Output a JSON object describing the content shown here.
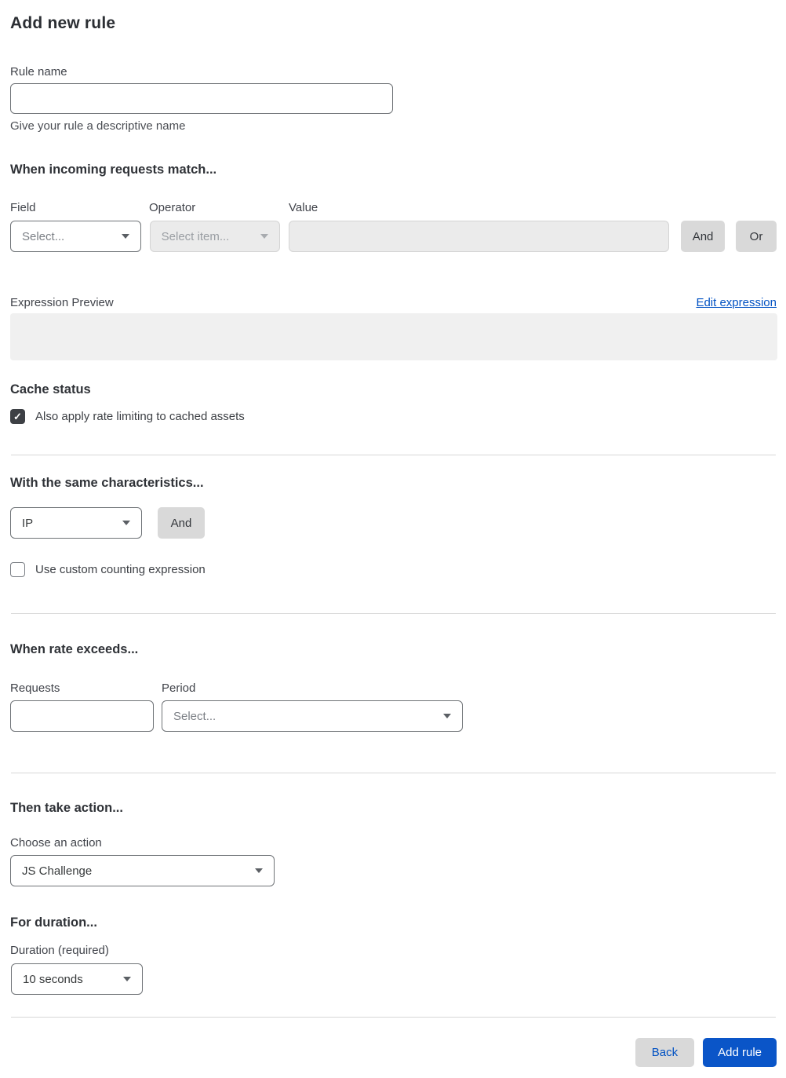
{
  "page": {
    "title": "Add new rule"
  },
  "colors": {
    "accent_blue": "#0051c3",
    "button_blue": "#0a55c8",
    "gray_button": "#d9d9d9",
    "disabled_bg": "#ebebeb",
    "preview_bg": "#f0f0f0"
  },
  "icons": {
    "checkmark": "✓"
  },
  "rule_name": {
    "label": "Rule name",
    "value": "",
    "helper": "Give your rule a descriptive name"
  },
  "match_section": {
    "heading": "When incoming requests match...",
    "field": {
      "label": "Field",
      "selected": "Select..."
    },
    "operator": {
      "label": "Operator",
      "selected": "Select item...",
      "disabled": true
    },
    "value": {
      "label": "Value",
      "value": "",
      "disabled": true
    },
    "and_button": "And",
    "or_button": "Or",
    "expression_preview_label": "Expression Preview",
    "edit_expression_link": "Edit expression",
    "expression_preview_value": ""
  },
  "cache_status": {
    "heading": "Cache status",
    "checkbox_label": "Also apply rate limiting to cached assets",
    "checked": true
  },
  "characteristics": {
    "heading": "With the same characteristics...",
    "select_value": "IP",
    "and_button": "And",
    "checkbox_label": "Use custom counting expression",
    "checked": false
  },
  "rate": {
    "heading": "When rate exceeds...",
    "requests_label": "Requests",
    "requests_value": "",
    "period_label": "Period",
    "period_selected": "Select..."
  },
  "action": {
    "heading": "Then take action...",
    "label": "Choose an action",
    "selected": "JS Challenge"
  },
  "duration": {
    "heading": "For duration...",
    "label": "Duration (required)",
    "selected": "10 seconds"
  },
  "footer": {
    "back_button": "Back",
    "add_rule_button": "Add rule"
  }
}
